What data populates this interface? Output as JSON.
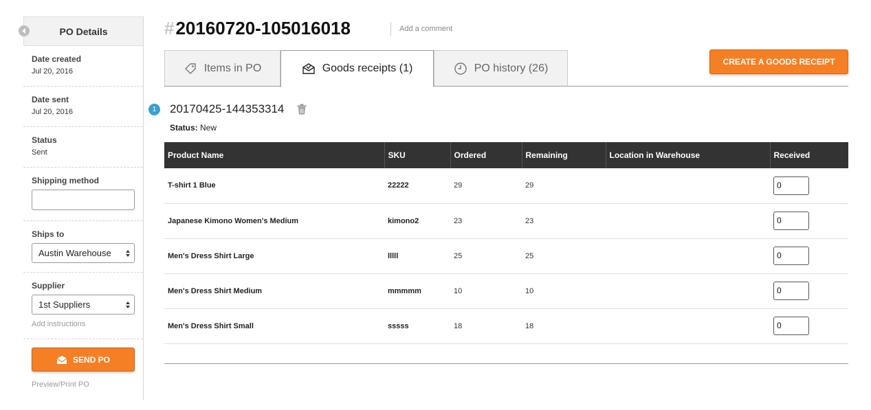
{
  "sidebar": {
    "title": "PO Details",
    "date_created_label": "Date created",
    "date_created_value": "Jul 20, 2016",
    "date_sent_label": "Date sent",
    "date_sent_value": "Jul 20, 2016",
    "status_label": "Status",
    "status_value": "Sent",
    "shipping_label": "Shipping method",
    "shipping_value": "",
    "ships_to_label": "Ships to",
    "ships_to_value": "Austin Warehouse",
    "supplier_label": "Supplier",
    "supplier_value": "1st Suppliers",
    "add_instructions": "Add instructions",
    "send_label": "SEND PO",
    "preview_label": "Preview/Print PO"
  },
  "header": {
    "hash": "#",
    "po_number": "20160720-105016018",
    "add_comment": "Add a comment"
  },
  "tabs": [
    {
      "label": "Items in PO",
      "icon": "tag-icon"
    },
    {
      "label": "Goods receipts (1)",
      "icon": "envelope-icon"
    },
    {
      "label": "PO history (26)",
      "icon": "clock-icon"
    }
  ],
  "actions": {
    "create_receipt": "CREATE A GOODS RECEIPT"
  },
  "receipt": {
    "index": "1",
    "id": "20170425-144353314",
    "status_label": "Status:",
    "status_value": "New"
  },
  "table": {
    "headers": [
      "Product Name",
      "SKU",
      "Ordered",
      "Remaining",
      "Location in Warehouse",
      "Received"
    ],
    "rows": [
      {
        "name": "T-shirt 1 Blue",
        "sku": "22222",
        "ordered": "29",
        "remaining": "29",
        "location": "",
        "received": "0"
      },
      {
        "name": "Japanese Kimono Women's Medium",
        "sku": "kimono2",
        "ordered": "23",
        "remaining": "23",
        "location": "",
        "received": "0"
      },
      {
        "name": "Men's Dress Shirt Large",
        "sku": "lllll",
        "ordered": "25",
        "remaining": "25",
        "location": "",
        "received": "0"
      },
      {
        "name": "Men's Dress Shirt Medium",
        "sku": "mmmmm",
        "ordered": "10",
        "remaining": "10",
        "location": "",
        "received": "0"
      },
      {
        "name": "Men's Dress Shirt Small",
        "sku": "sssss",
        "ordered": "18",
        "remaining": "18",
        "location": "",
        "received": "0"
      }
    ]
  },
  "colors": {
    "accent": "#f47f24",
    "badge": "#3a9fd6",
    "table_header": "#333333"
  }
}
